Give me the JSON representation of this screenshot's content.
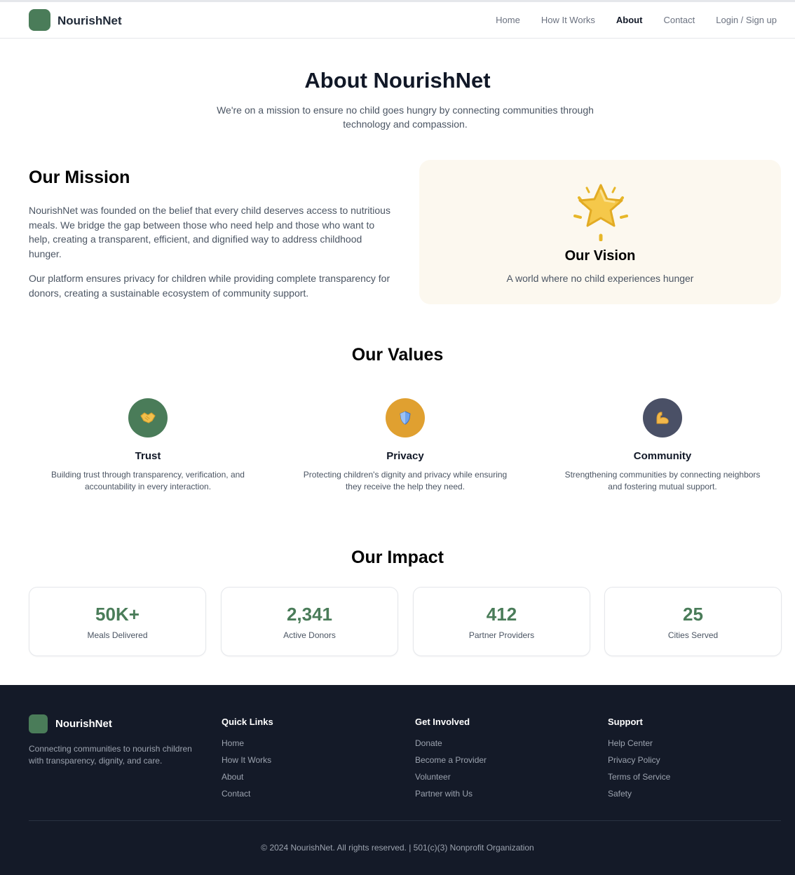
{
  "header": {
    "brand": "NourishNet",
    "nav": [
      {
        "label": "Home",
        "active": false
      },
      {
        "label": "How It Works",
        "active": false
      },
      {
        "label": "About",
        "active": true
      },
      {
        "label": "Contact",
        "active": false
      },
      {
        "label": "Login / Sign up",
        "active": false
      }
    ]
  },
  "hero": {
    "title": "About NourishNet",
    "subtitle": "We're on a mission to ensure no child goes hungry by connecting communities through technology and compassion."
  },
  "mission": {
    "title": "Our Mission",
    "paragraph1": "NourishNet was founded on the belief that every child deserves access to nutritious meals. We bridge the gap between those who need help and those who want to help, creating a transparent, efficient, and dignified way to address childhood hunger.",
    "paragraph2": "Our platform ensures privacy for children while providing complete transparency for donors, creating a sustainable ecosystem of community support."
  },
  "vision": {
    "icon": "star-icon",
    "title": "Our Vision",
    "text": "A world where no child experiences hunger"
  },
  "values": {
    "title": "Our Values",
    "items": [
      {
        "icon": "handshake-icon",
        "color": "#4a7c59",
        "title": "Trust",
        "description": "Building trust through transparency, verification, and accountability in every interaction."
      },
      {
        "icon": "shield-icon",
        "color": "#e0a030",
        "title": "Privacy",
        "description": "Protecting children's dignity and privacy while ensuring they receive the help they need."
      },
      {
        "icon": "flexed-biceps-icon",
        "color": "#4a5066",
        "title": "Community",
        "description": "Strengthening communities by connecting neighbors and fostering mutual support."
      }
    ]
  },
  "impact": {
    "title": "Our Impact",
    "stats": [
      {
        "value": "50K+",
        "label": "Meals Delivered"
      },
      {
        "value": "2,341",
        "label": "Active Donors"
      },
      {
        "value": "412",
        "label": "Partner Providers"
      },
      {
        "value": "25",
        "label": "Cities Served"
      }
    ]
  },
  "footer": {
    "brand": "NourishNet",
    "tagline": "Connecting communities to nourish children with transparency, dignity, and care.",
    "columns": [
      {
        "heading": "Quick Links",
        "links": [
          "Home",
          "How It Works",
          "About",
          "Contact"
        ]
      },
      {
        "heading": "Get Involved",
        "links": [
          "Donate",
          "Become a Provider",
          "Volunteer",
          "Partner with Us"
        ]
      },
      {
        "heading": "Support",
        "links": [
          "Help Center",
          "Privacy Policy",
          "Terms of Service",
          "Safety"
        ]
      }
    ],
    "copyright": "© 2024 NourishNet. All rights reserved. | 501(c)(3) Nonprofit Organization"
  }
}
